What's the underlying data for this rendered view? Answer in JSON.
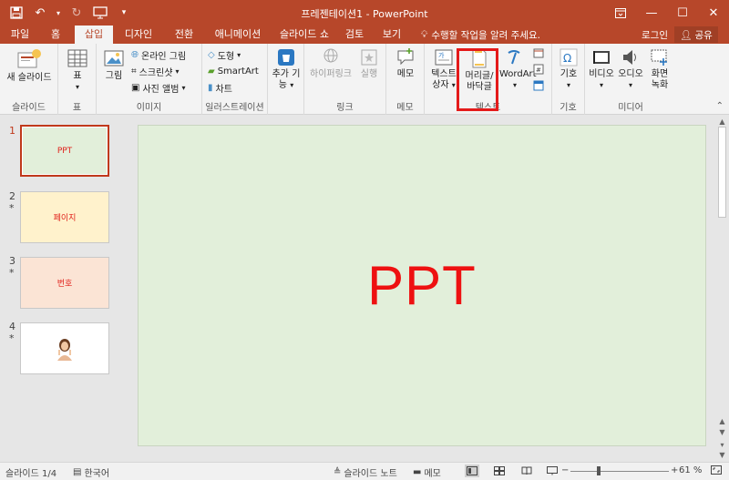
{
  "window": {
    "title": "프레젠테이션1 - PowerPoint",
    "qat": [
      "save-icon",
      "undo-icon",
      "redo-icon",
      "present-icon",
      "customize-icon"
    ]
  },
  "tabs": {
    "items": [
      "파일",
      "홈",
      "삽입",
      "디자인",
      "전환",
      "애니메이션",
      "슬라이드 쇼",
      "검토",
      "보기"
    ],
    "active": "삽입",
    "tell_me": "수행할 작업을 알려 주세요.",
    "login": "로그인",
    "share": "공유"
  },
  "ribbon": {
    "groups": {
      "slides": "슬라이드",
      "tables": "표",
      "images": "이미지",
      "illustrations": "일러스트레이션",
      "links": "링크",
      "comments": "메모",
      "text": "텍스트",
      "symbols": "기호",
      "media": "미디어"
    },
    "new_slide": "새 슬라이드",
    "table": "표",
    "picture": "그림",
    "online_picture": "온라인 그림",
    "screenshot": "스크린샷",
    "photo_album": "사진 앨범",
    "shapes": "도형",
    "smartart": "SmartArt",
    "chart": "차트",
    "addins_line1": "추가 기",
    "addins_line2": "능",
    "hyperlink": "하이퍼링크",
    "action": "실행",
    "comment": "메모",
    "textbox_line1": "텍스트",
    "textbox_line2": "상자",
    "header_footer_line1": "머리글/",
    "header_footer_line2": "바닥글",
    "wordart": "WordArt",
    "symbol": "기호",
    "video": "비디오",
    "audio": "오디오",
    "screen_rec_line1": "화면",
    "screen_rec_line2": "녹화"
  },
  "slides": [
    {
      "number": "1",
      "text": "PPT",
      "color": "#e2efda"
    },
    {
      "number": "2",
      "star": "*",
      "text": "페이지",
      "color": "#fff2cc"
    },
    {
      "number": "3",
      "star": "*",
      "text": "번호",
      "color": "#fbe4d5"
    },
    {
      "number": "4",
      "star": "*",
      "text": "",
      "color": "#ffffff"
    }
  ],
  "main_slide": {
    "title": "PPT",
    "background": "#e2efda",
    "title_color": "#ee1111"
  },
  "status": {
    "slide_count": "슬라이드 1/4",
    "language": "한국어",
    "notes": "슬라이드 노트",
    "comments": "메모",
    "zoom": "61 %",
    "zoom_level": 0.61
  },
  "colors": {
    "accent": "#b7472a",
    "highlight": "#e41a1a"
  }
}
